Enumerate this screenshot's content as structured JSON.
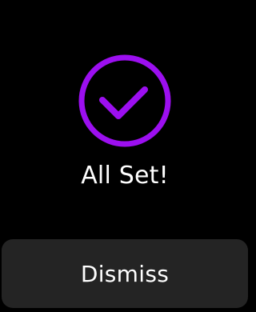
{
  "confirmation": {
    "title": "All Set!",
    "icon": "checkmark-circle-icon",
    "accent_color": "#9c0ff0"
  },
  "actions": {
    "dismiss_label": "Dismiss"
  },
  "colors": {
    "background": "#000000",
    "button_background": "#242424",
    "text": "#ffffff"
  }
}
